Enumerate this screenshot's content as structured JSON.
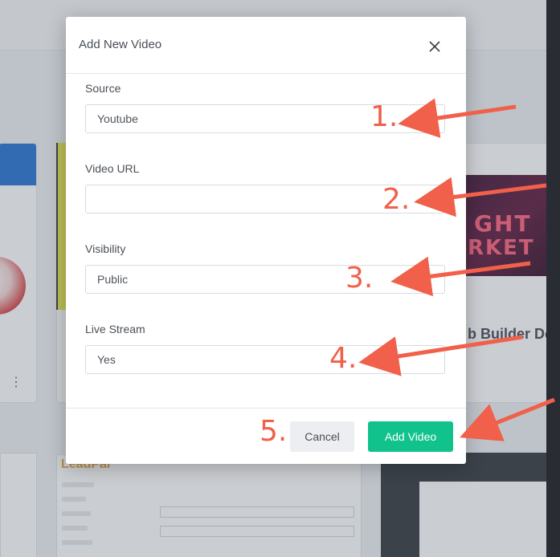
{
  "modal": {
    "title": "Add New Video",
    "close_icon": "close-icon",
    "fields": [
      {
        "label": "Source",
        "value": "Youtube"
      },
      {
        "label": "Video URL",
        "value": ""
      },
      {
        "label": "Visibility",
        "value": "Public"
      },
      {
        "label": "Live Stream",
        "value": "Yes"
      }
    ],
    "cancel_label": "Cancel",
    "submit_label": "Add Video"
  },
  "annotations": {
    "steps": [
      "1.",
      "2.",
      "3.",
      "4.",
      "5."
    ],
    "color": "#f0604a"
  },
  "background": {
    "heading_fragment": "b Builder De",
    "logo_fragment": "LeadPal",
    "neon_text": [
      "GHT",
      "RKET"
    ]
  },
  "colors": {
    "accent": "#12c28c",
    "cancel_bg": "#eceef1"
  }
}
